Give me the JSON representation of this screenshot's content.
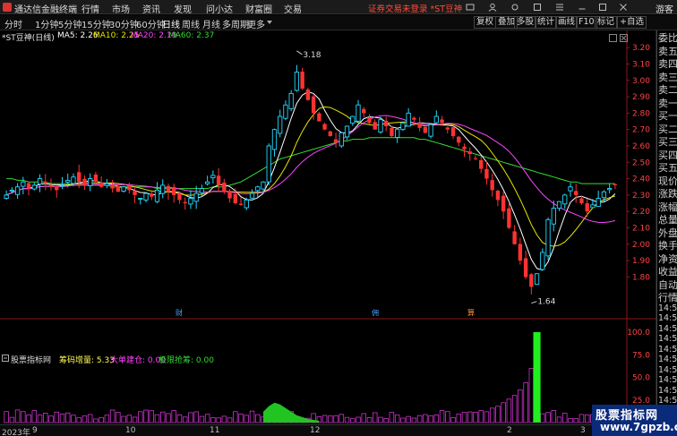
{
  "menubar": {
    "app_title": "通达信金融终端",
    "menus": [
      "行情",
      "市场",
      "资讯",
      "发现",
      "问小达",
      "财富圈",
      "交易"
    ],
    "notice": "证券交易未登录 *ST豆神",
    "guest": "游客"
  },
  "toolbar": {
    "periods": [
      "分时",
      "1分钟",
      "5分钟",
      "15分钟",
      "30分钟",
      "60分钟",
      "日线",
      "周线",
      "月线",
      "多周期",
      "更多"
    ],
    "active_period": "日线",
    "right_buttons": [
      "复权",
      "叠加",
      "多股",
      "统计",
      "画线",
      "F10",
      "标记",
      "+自选"
    ]
  },
  "info": {
    "stock": "*ST豆神(日线)",
    "ma5": "MA5: 2.26",
    "ma10": "MA10: 2.25",
    "ma20": "MA20: 2.19",
    "ma60": "MA60: 2.37"
  },
  "annotations": {
    "high_label": "3.18",
    "low_label": "1.64",
    "markers": [
      {
        "text": "财",
        "color": "#4aa0ff"
      },
      {
        "text": "佣",
        "color": "#4aa0ff"
      },
      {
        "text": "算",
        "color": "#ff9a3a"
      }
    ]
  },
  "indicator": {
    "name": "股票指标网",
    "v1": "筹码增量: 5.33",
    "v2": "大单建仓: 0.00",
    "v3": "极限抢筹: 0.00"
  },
  "price_axis": [
    "3.20",
    "3.10",
    "3.00",
    "2.90",
    "2.80",
    "2.70",
    "2.60",
    "2.50",
    "2.40",
    "2.30",
    "2.20",
    "2.10",
    "2.00",
    "1.90",
    "1.80"
  ],
  "indicator_axis": [
    "100.0",
    "75.0",
    "50.0",
    "25.0"
  ],
  "date_axis": [
    "2023年",
    "9",
    "10",
    "11",
    "12",
    "2",
    "3"
  ],
  "quote_panel": {
    "labels": [
      "委比",
      "卖五",
      "卖四",
      "卖三",
      "卖二",
      "卖一",
      "买一",
      "买二",
      "买三",
      "买四",
      "买五",
      "现价",
      "涨跌",
      "涨幅",
      "总量",
      "外盘",
      "换手",
      "净资",
      "收益",
      "自动",
      "行情"
    ],
    "times": [
      "14:54",
      "14:54",
      "14:55",
      "14:55",
      "14:55",
      "14:55",
      "14:55",
      "14:55",
      "14:55",
      "14:56"
    ]
  },
  "watermark": {
    "line1": "股票指标网",
    "line2": "www.7gpzb.com"
  },
  "colors": {
    "up": "#22d8ff",
    "down": "#ff3232",
    "ma5": "#ffffff",
    "ma10": "#e6e600",
    "ma20": "#ff44ff",
    "ma60": "#33dd33",
    "accent_red": "#ff4b3b"
  },
  "chart_data": {
    "type": "candlestick",
    "y_range": [
      1.6,
      3.25
    ],
    "high": 3.18,
    "low": 1.64,
    "closes": [
      2.3,
      2.33,
      2.35,
      2.38,
      2.34,
      2.36,
      2.4,
      2.37,
      2.35,
      2.33,
      2.36,
      2.39,
      2.41,
      2.38,
      2.36,
      2.4,
      2.38,
      2.35,
      2.37,
      2.34,
      2.32,
      2.35,
      2.33,
      2.3,
      2.28,
      2.31,
      2.29,
      2.33,
      2.36,
      2.32,
      2.3,
      2.27,
      2.25,
      2.28,
      2.31,
      2.34,
      2.38,
      2.42,
      2.36,
      2.32,
      2.28,
      2.25,
      2.24,
      2.27,
      2.31,
      2.35,
      2.38,
      2.6,
      2.7,
      2.78,
      2.85,
      2.92,
      3.05,
      2.95,
      2.88,
      2.8,
      2.75,
      2.7,
      2.66,
      2.62,
      2.68,
      2.72,
      2.78,
      2.85,
      2.8,
      2.74,
      2.7,
      2.76,
      2.72,
      2.66,
      2.7,
      2.74,
      2.8,
      2.76,
      2.71,
      2.68,
      2.73,
      2.78,
      2.74,
      2.7,
      2.66,
      2.62,
      2.58,
      2.55,
      2.52,
      2.46,
      2.4,
      2.33,
      2.27,
      2.2,
      2.1,
      2.0,
      1.9,
      1.8,
      1.74,
      1.82,
      1.95,
      2.15,
      2.22,
      2.26,
      2.3,
      2.35,
      2.3,
      2.25,
      2.2,
      2.24,
      2.28,
      2.32,
      2.34,
      2.36
    ],
    "ma60": [
      2.4,
      2.4,
      2.39,
      2.39,
      2.38,
      2.38,
      2.38,
      2.38,
      2.37,
      2.37,
      2.37,
      2.37,
      2.36,
      2.36,
      2.36,
      2.36,
      2.36,
      2.36,
      2.36,
      2.35,
      2.35,
      2.35,
      2.35,
      2.35,
      2.35,
      2.35,
      2.35,
      2.34,
      2.34,
      2.34,
      2.34,
      2.34,
      2.34,
      2.34,
      2.34,
      2.34,
      2.34,
      2.35,
      2.35,
      2.35,
      2.36,
      2.37,
      2.38,
      2.4,
      2.42,
      2.44,
      2.46,
      2.48,
      2.5,
      2.52,
      2.53,
      2.54,
      2.55,
      2.56,
      2.57,
      2.58,
      2.59,
      2.6,
      2.61,
      2.62,
      2.63,
      2.63,
      2.64,
      2.64,
      2.64,
      2.65,
      2.65,
      2.65,
      2.65,
      2.65,
      2.65,
      2.65,
      2.65,
      2.65,
      2.64,
      2.64,
      2.63,
      2.62,
      2.61,
      2.6,
      2.59,
      2.58,
      2.57,
      2.56,
      2.55,
      2.54,
      2.53,
      2.52,
      2.51,
      2.5,
      2.49,
      2.48,
      2.47,
      2.46,
      2.45,
      2.44,
      2.43,
      2.42,
      2.41,
      2.4,
      2.39,
      2.38,
      2.38,
      2.37,
      2.37,
      2.37,
      2.37,
      2.37,
      2.37,
      2.37
    ],
    "indicator": {
      "name": "筹码增量",
      "values": [
        0,
        0,
        0,
        0,
        0,
        0,
        0,
        0,
        0,
        0,
        0,
        0,
        0,
        0,
        0,
        0,
        0,
        0,
        0,
        0,
        0,
        0,
        0,
        0,
        12,
        10,
        8,
        4,
        0,
        0,
        0,
        0,
        0,
        0,
        0,
        0,
        0,
        0,
        0,
        0,
        0,
        0,
        0,
        0,
        0,
        0,
        0,
        0,
        0,
        0,
        0,
        0,
        0,
        0,
        0,
        0,
        0,
        0,
        0,
        0,
        0,
        0,
        0,
        0,
        0,
        0,
        0,
        0,
        0,
        0,
        0,
        0,
        0,
        0,
        0,
        0,
        0,
        0,
        0,
        0,
        0,
        0,
        0,
        6,
        8,
        10,
        12,
        16,
        18,
        22,
        26,
        30,
        36,
        44,
        60,
        100,
        0,
        0,
        0,
        0,
        0,
        0,
        0,
        0,
        0,
        0,
        0,
        0,
        0,
        0
      ],
      "green_values": [
        0,
        0,
        0,
        0,
        0,
        0,
        0,
        0,
        0,
        0,
        0,
        0,
        0,
        0,
        0,
        0,
        0,
        0,
        0,
        0,
        0,
        0,
        0,
        0,
        0,
        0,
        0,
        0,
        0,
        0,
        0,
        0,
        0,
        0,
        0,
        0,
        0,
        0,
        0,
        0,
        0,
        0,
        0,
        0,
        0,
        0,
        12,
        18,
        22,
        20,
        16,
        12,
        8,
        6,
        4,
        3,
        2,
        0,
        0,
        0,
        0,
        0,
        0,
        0,
        0,
        0,
        0,
        0,
        0,
        0,
        0,
        0,
        0,
        0,
        0,
        0,
        0,
        0,
        0,
        0,
        0,
        0,
        0,
        0,
        0,
        0,
        0,
        0,
        0,
        0,
        0,
        0,
        0,
        0,
        0,
        100,
        0,
        0,
        0,
        0,
        0,
        0,
        0,
        0,
        0,
        0,
        0,
        0,
        0,
        0
      ]
    }
  }
}
